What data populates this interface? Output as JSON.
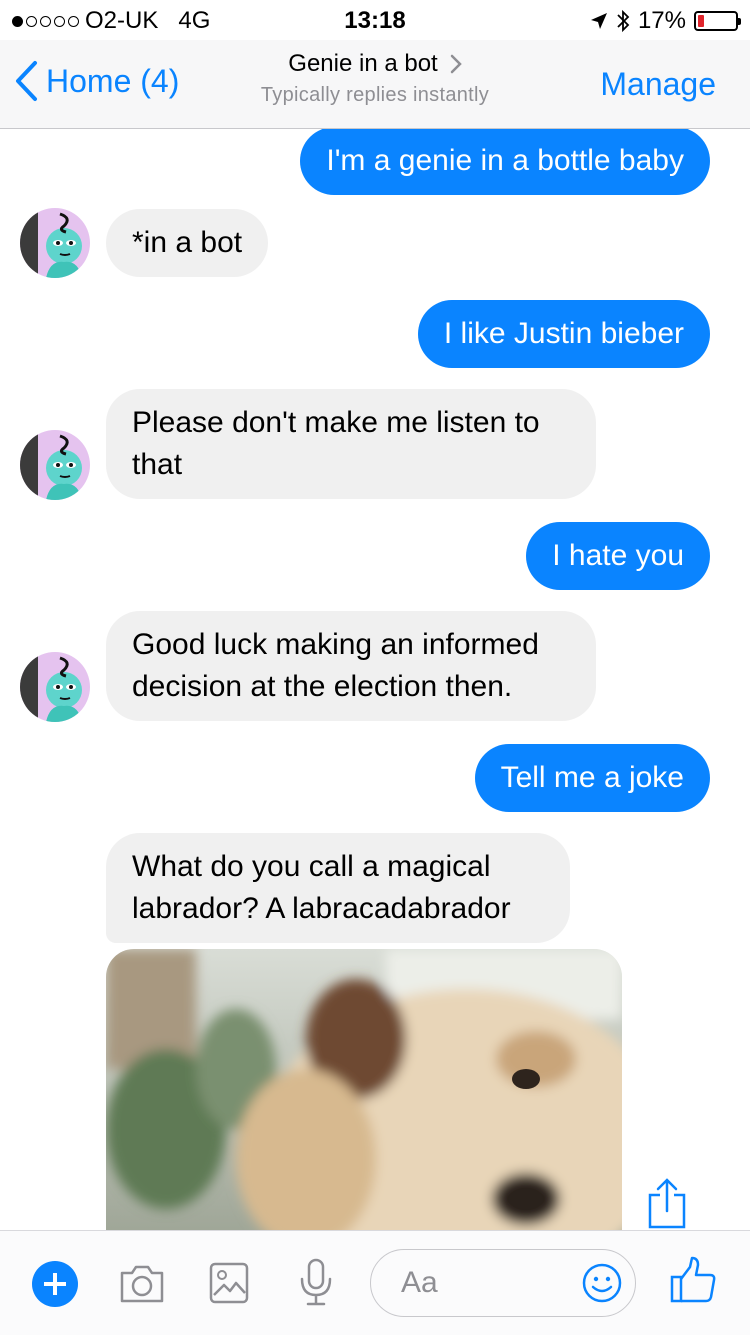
{
  "status_bar": {
    "carrier": "O2-UK",
    "network": "4G",
    "time": "13:18",
    "battery": "17%",
    "signal_bars": 1,
    "battery_level": 0.17,
    "battery_color": "#e0242b"
  },
  "nav": {
    "back_label": "Home (4)",
    "title": "Genie in a bot",
    "subtitle": "Typically replies instantly",
    "manage_label": "Manage"
  },
  "messages": [
    {
      "from": "me",
      "text": "I'm a genie in a bottle baby"
    },
    {
      "from": "bot",
      "text": "*in a bot"
    },
    {
      "from": "me",
      "text": "I like Justin bieber"
    },
    {
      "from": "bot",
      "text": "Please don't make me listen to that"
    },
    {
      "from": "me",
      "text": "I hate you"
    },
    {
      "from": "bot",
      "text": "Good luck making an informed decision at the election then."
    },
    {
      "from": "me",
      "text": "Tell me a joke"
    },
    {
      "from": "bot",
      "text": "What do you call a magical labrador? A labracadabrador"
    }
  ],
  "composer": {
    "placeholder": "Aa"
  },
  "colors": {
    "accent": "#0a84ff",
    "incoming_bubble": "#f0f0f0"
  }
}
